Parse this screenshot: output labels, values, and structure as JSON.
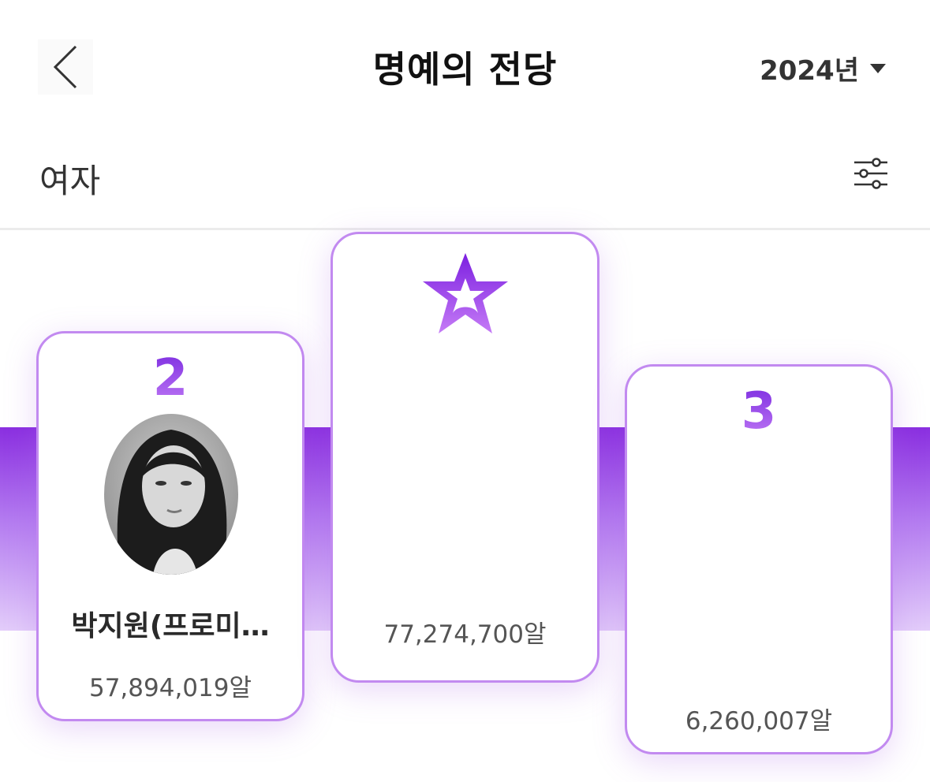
{
  "header": {
    "back_icon": "chevron-left-icon",
    "title": "명예의 전당",
    "year": "2024년",
    "year_caret_icon": "caret-down-icon"
  },
  "filter": {
    "gender": "여자",
    "settings_icon": "sliders-icon"
  },
  "ranking": [
    {
      "rank": "2",
      "name": "박지원(프로미…",
      "amount": "57,894,019알"
    },
    {
      "rank": "1",
      "rank_icon": "star-icon",
      "name": "",
      "amount": "77,274,700알"
    },
    {
      "rank": "3",
      "name": "",
      "amount": "6,260,007알"
    }
  ],
  "colors": {
    "accent": "#9a3ce6",
    "card_border": "#c28af0",
    "band_top": "#8a2fe0",
    "band_bottom": "#e3cdfa"
  }
}
